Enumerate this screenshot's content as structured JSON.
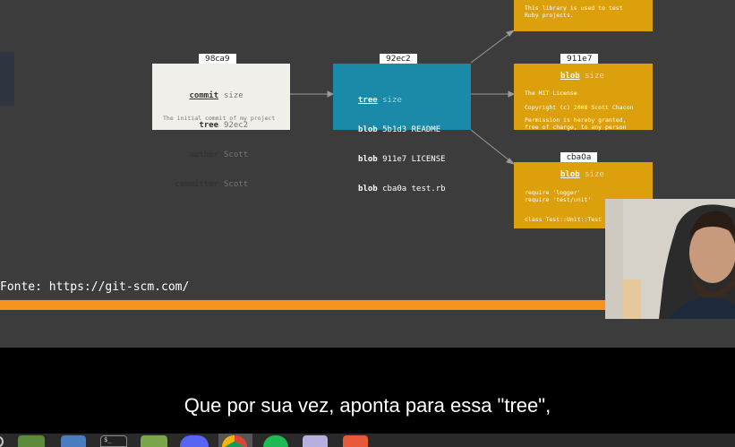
{
  "top_blob": {
    "desc": "This library is used to test\nRuby projects."
  },
  "commit_obj": {
    "hash": "98ca9",
    "rows": [
      {
        "key": "commit",
        "val": "size"
      },
      {
        "key": "tree",
        "val": "92ec2"
      },
      {
        "key": "author",
        "val": "Scott"
      },
      {
        "key": "committer",
        "val": "Scott"
      }
    ],
    "message": "The initial commit of my project"
  },
  "tree_obj": {
    "hash": "92ec2",
    "rows": [
      {
        "key": "tree",
        "val": "size"
      },
      {
        "key": "blob",
        "val": "5b1d3 README"
      },
      {
        "key": "blob",
        "val": "911e7 LICENSE"
      },
      {
        "key": "blob",
        "val": "cba0a test.rb"
      }
    ]
  },
  "blob_license": {
    "hash": "911e7",
    "key": "blob",
    "val": "size",
    "lines": [
      "The MIT License",
      "",
      "Copyright (c) 2008 Scott Chacon",
      "",
      "Permission is hereby granted,",
      "free of charge, to any person"
    ]
  },
  "blob_test": {
    "hash": "cba0a",
    "key": "blob",
    "val": "size",
    "lines": [
      "require 'logger'",
      "require 'test/unit'",
      "",
      "class Test::Unit::Test"
    ]
  },
  "source": "Fonte: https://git-scm.com/",
  "subtitle": "Que por sua vez, aponta para essa \"tree\",",
  "colors": {
    "commit_bg": "#f1efe9",
    "tree_bg": "#1a8aa8",
    "blob_bg": "#dca00c",
    "bar": "#f7931e"
  },
  "taskbar": [
    "power-icon",
    "files-icon",
    "window-icon",
    "terminal-icon",
    "folder-icon",
    "discord-icon",
    "chrome-icon",
    "spotify-icon",
    "notes-icon",
    "photo-icon"
  ]
}
